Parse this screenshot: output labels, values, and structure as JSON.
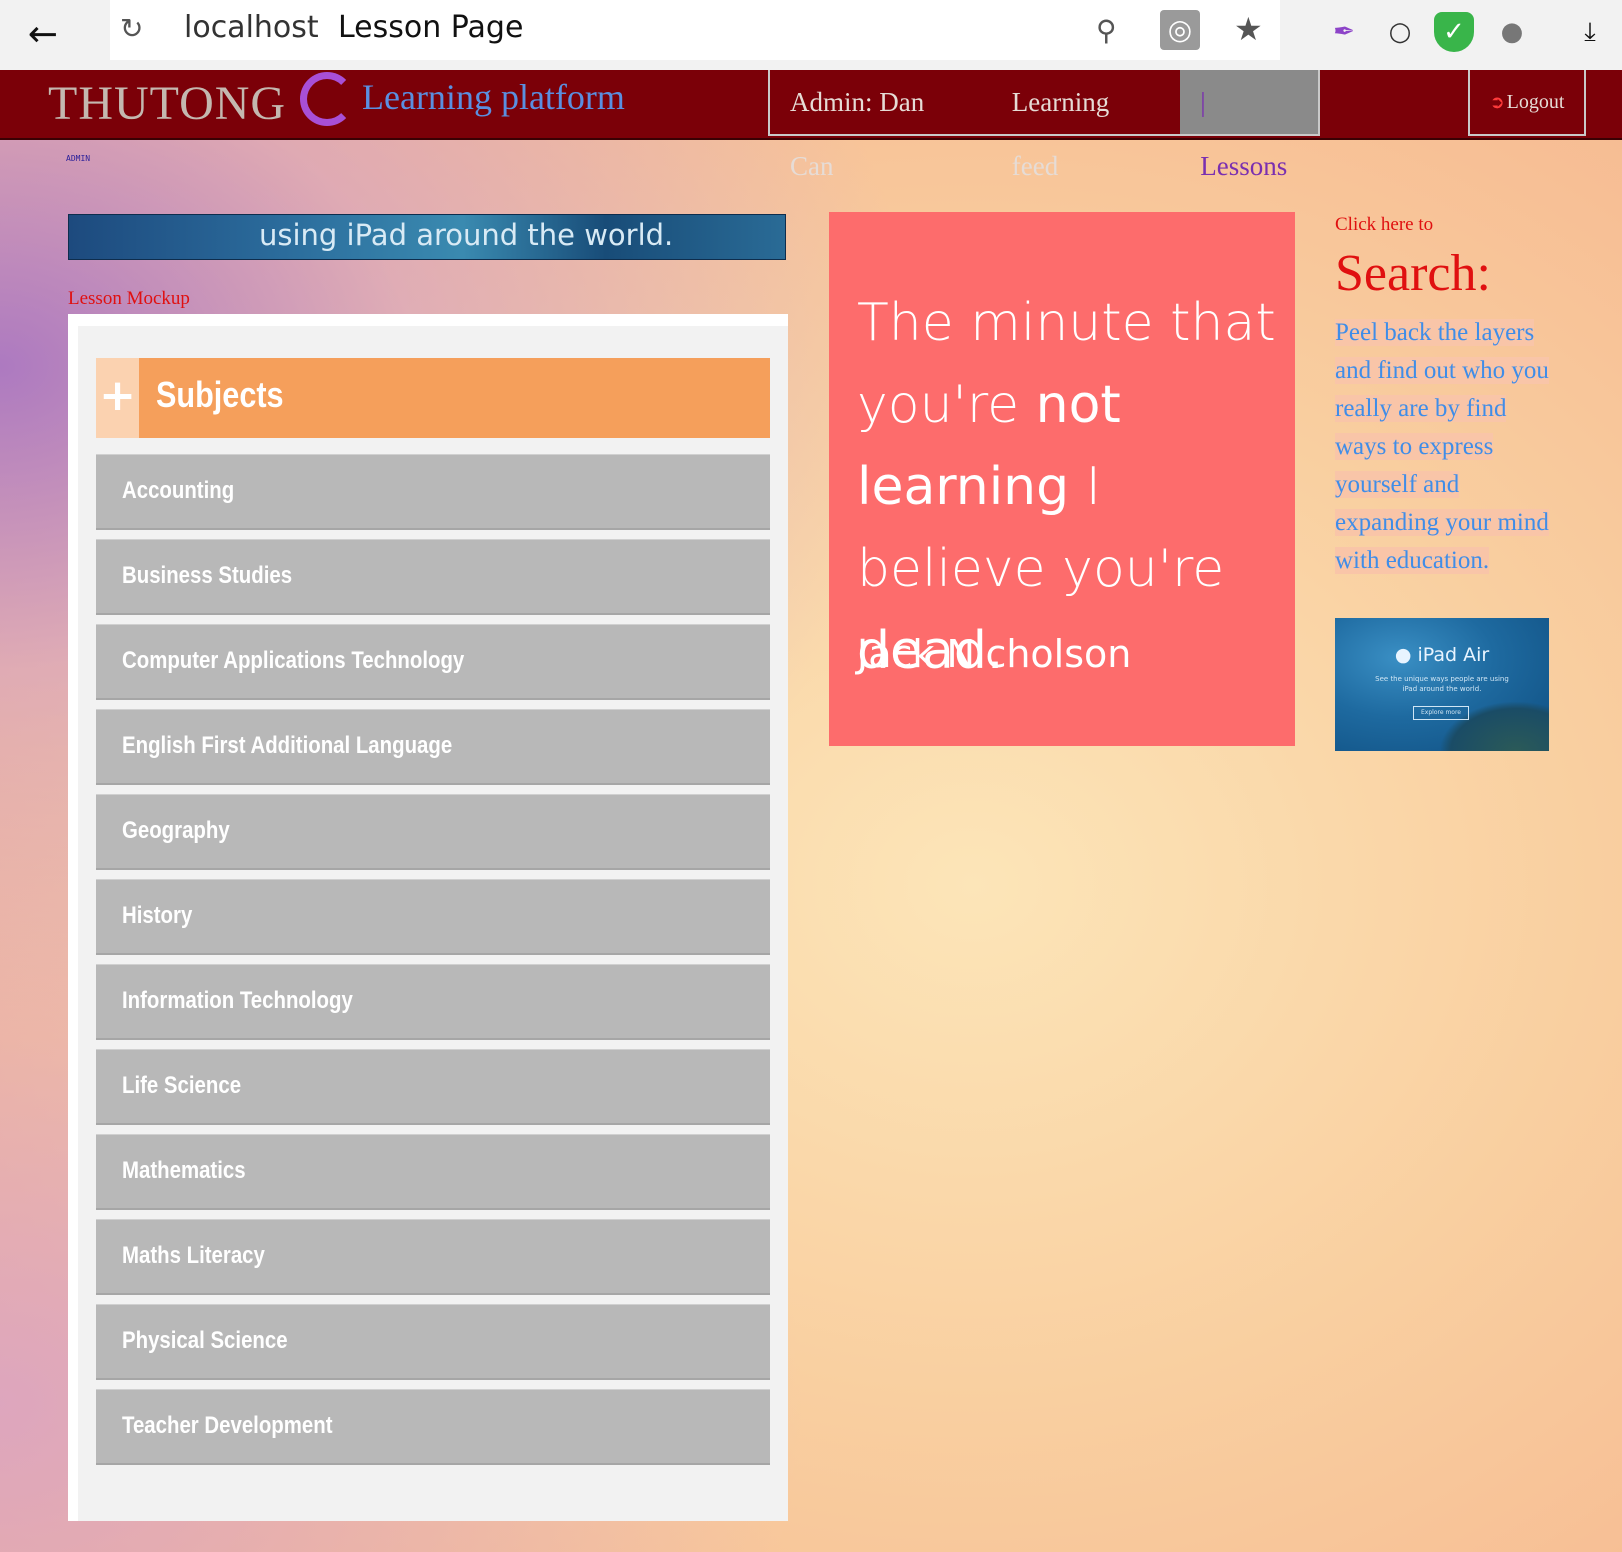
{
  "browser": {
    "host": "localhost",
    "page_title": "Lesson Page"
  },
  "nav": {
    "brand": "THUTONG",
    "tagline": "Learning platform",
    "admin": "Admin: Dan Can",
    "feed": "Learning feed",
    "lessons": "| Lessons",
    "logout": "Logout",
    "admin_tag": "ADMIN"
  },
  "banner_text": "using iPad around the world.",
  "lesson_label": "Lesson Mockup",
  "subjects": {
    "header": "Subjects",
    "items": [
      "Accounting",
      "Business Studies",
      "Computer Applications Technology",
      "English First Additional Language",
      "Geography",
      "History",
      "Information Technology",
      "Life Science",
      "Mathematics",
      "Maths Literacy",
      "Physical Science",
      "Teacher Development"
    ]
  },
  "quote": {
    "p1": "The minute that you're ",
    "b1": "not learning",
    "p2": " I believe you're ",
    "b2": "dead.",
    "author": "Jack Nicholson"
  },
  "sidebar": {
    "click_here": "Click here to",
    "search": "Search:",
    "motto": "Peel back the layers and find out who you really are by find ways to express yourself and expanding your mind with education."
  },
  "ad": {
    "title": "iPad Air",
    "subtitle": "See the unique ways people are using iPad around the world.",
    "button": "Explore more"
  },
  "colors": {
    "navbar": "#7b0008",
    "subjects_header": "#f59f5b",
    "subject_item": "#b8b8b8",
    "quote_card": "#fd6c6c",
    "accent_red": "#e01010",
    "motto_blue": "#3f8de8"
  },
  "icons": [
    "back-arrow-icon",
    "reload-icon",
    "zoom-icon",
    "globe-icon",
    "star-icon",
    "quill-icon",
    "bulb-icon",
    "shield-icon",
    "balls-icon",
    "download-icon",
    "logout-icon",
    "plus-icon",
    "apple-icon"
  ]
}
